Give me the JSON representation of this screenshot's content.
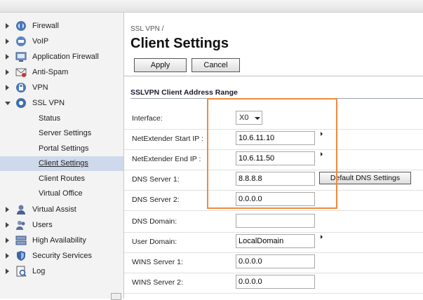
{
  "sidebar": {
    "items": [
      {
        "label": "Firewall",
        "icon": "firewall-icon"
      },
      {
        "label": "VoIP",
        "icon": "voip-icon"
      },
      {
        "label": "Application Firewall",
        "icon": "application-firewall-icon"
      },
      {
        "label": "Anti-Spam",
        "icon": "anti-spam-icon"
      },
      {
        "label": "VPN",
        "icon": "vpn-icon"
      },
      {
        "label": "SSL VPN",
        "icon": "ssl-vpn-icon"
      }
    ],
    "ssl_vpn_sub": [
      "Status",
      "Server Settings",
      "Portal Settings",
      "Client Settings",
      "Client Routes",
      "Virtual Office"
    ],
    "items_after": [
      {
        "label": "Virtual Assist",
        "icon": "virtual-assist-icon"
      },
      {
        "label": "Users",
        "icon": "users-icon"
      },
      {
        "label": "High Availability",
        "icon": "high-availability-icon"
      },
      {
        "label": "Security Services",
        "icon": "security-services-icon"
      },
      {
        "label": "Log",
        "icon": "log-icon"
      }
    ]
  },
  "main": {
    "breadcrumb": "SSL VPN /",
    "title": "Client Settings",
    "apply_label": "Apply",
    "cancel_label": "Cancel",
    "section_title": "SSLVPN Client Address Range",
    "default_dns_label": "Default DNS Settings",
    "fields": {
      "interface": {
        "label": "Interface:",
        "value": "X0"
      },
      "start_ip": {
        "label": "NetExtender Start IP :",
        "value": "10.6.11.10"
      },
      "end_ip": {
        "label": "NetExtender End IP :",
        "value": "10.6.11.50"
      },
      "dns1": {
        "label": "DNS Server 1:",
        "value": "8.8.8.8"
      },
      "dns2": {
        "label": "DNS Server 2:",
        "value": "0.0.0.0"
      },
      "dns_domain": {
        "label": "DNS Domain:",
        "value": ""
      },
      "user_domain": {
        "label": "User Domain:",
        "value": "LocalDomain"
      },
      "wins1": {
        "label": "WINS Server 1:",
        "value": "0.0.0.0"
      },
      "wins2": {
        "label": "WINS Server 2:",
        "value": "0.0.0.0"
      }
    }
  },
  "colors": {
    "highlight": "#f08a3a",
    "active_bg": "#cfd9ec"
  }
}
